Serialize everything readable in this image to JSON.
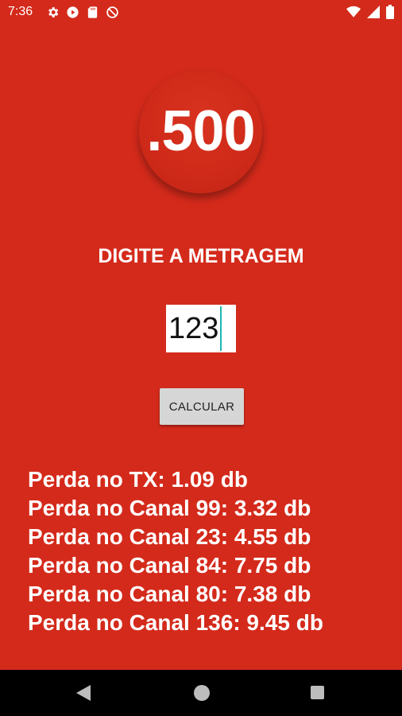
{
  "status_bar": {
    "time": "7:36",
    "left_icons": [
      "gear-icon",
      "play-icon",
      "sd-card-icon",
      "blocked-icon"
    ],
    "right_icons": [
      "wifi-icon",
      "signal-icon",
      "battery-icon"
    ]
  },
  "logo": {
    "text": ".500"
  },
  "prompt": {
    "label": "DIGITE A METRAGEM"
  },
  "meter_input": {
    "value": "123"
  },
  "calculate_button": {
    "label": "CALCULAR"
  },
  "results": [
    "Perda no TX: 1.09 db",
    "Perda no Canal 99: 3.32 db",
    "Perda no Canal 23: 4.55 db",
    "Perda no Canal 84: 7.75 db",
    "Perda no Canal 80: 7.38 db",
    "Perda no Canal 136: 9.45 db"
  ],
  "nav_bar": {
    "icons": [
      "back-icon",
      "home-icon",
      "recents-icon"
    ]
  },
  "colors": {
    "background": "#d42a1b",
    "nav_bar": "#000000",
    "caret": "#1fb6b0",
    "button": "#d6d6d6"
  }
}
